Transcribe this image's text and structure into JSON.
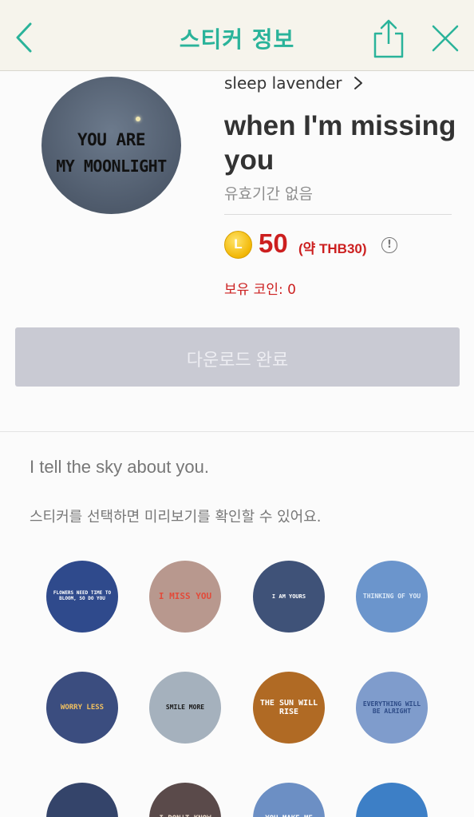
{
  "header": {
    "title": "스티커 정보",
    "back_icon": "chevron-left-icon",
    "share_icon": "share-icon",
    "close_icon": "close-icon",
    "accent_color": "#2ab39a"
  },
  "sticker_info": {
    "main_image_text_line1": "YOU ARE",
    "main_image_text_line2": "MY MOONLIGHT",
    "author": "sleep lavender",
    "title": "when I'm missing you",
    "validity": "유효기간 없음",
    "coin_symbol": "L",
    "price": "50",
    "price_approx": "(약 THB30)",
    "info_icon": "info-icon",
    "coins_owned": "보유 코인: 0",
    "price_color": "#cc1f1f"
  },
  "download_button": {
    "label": "다운로드 완료",
    "state": "disabled"
  },
  "description": "I tell the sky about you.",
  "preview_hint": "스티커를 선택하면 미리보기를 확인할 수 있어요.",
  "stickers": [
    {
      "text": "FLOWERS NEED TIME TO BLOOM, SO DO YOU",
      "bg": "#2f4a8c",
      "color": "#ffffff"
    },
    {
      "text": "I MISS YOU",
      "bg": "#b8988e",
      "color": "#e24b3a"
    },
    {
      "text": "I AM YOURS",
      "bg": "#3f5278",
      "color": "#ffffff"
    },
    {
      "text": "THINKING OF YOU",
      "bg": "#6b95cc",
      "color": "#dce9f7"
    },
    {
      "text": "WORRY LESS",
      "bg": "#3b4d7f",
      "color": "#f0c060"
    },
    {
      "text": "SMILE MORE",
      "bg": "#a5b1bd",
      "color": "#1a1a1a"
    },
    {
      "text": "THE SUN WILL RISE",
      "bg": "#b06a24",
      "color": "#ffffff"
    },
    {
      "text": "EVERYTHING WILL BE ALRIGHT",
      "bg": "#7f9ccc",
      "color": "#2c4a86"
    },
    {
      "text": "",
      "bg": "#34446a",
      "color": "#ffffff"
    },
    {
      "text": "I DON'T KNOW",
      "bg": "#5a4a4a",
      "color": "#f0e0d0"
    },
    {
      "text": "YOU MAKE ME",
      "bg": "#6c8fc4",
      "color": "#ffffff"
    },
    {
      "text": "",
      "bg": "#3d7fc6",
      "color": "#ffffff"
    }
  ]
}
